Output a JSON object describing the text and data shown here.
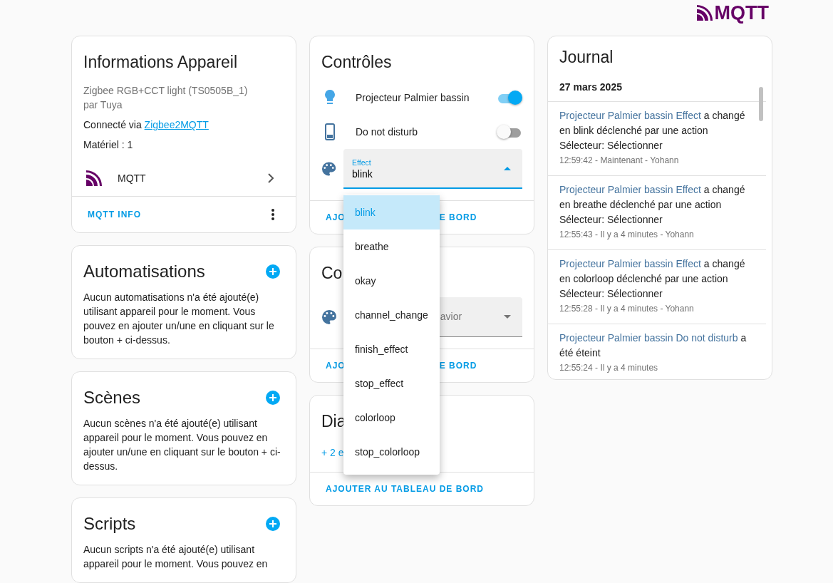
{
  "logo": {
    "text": "MQTT"
  },
  "device_info": {
    "title": "Informations Appareil",
    "model": "Zigbee RGB+CCT light (TS0505B_1)",
    "manufacturer": "par Tuya",
    "connected_label": "Connecté via",
    "connected_link": "Zigbee2MQTT",
    "hardware": "Matériel : 1",
    "integration": "MQTT",
    "action": "MQTT INFO"
  },
  "related": [
    {
      "title": "Automatisations",
      "text": "Aucun automatisations n'a été ajouté(e) utilisant appareil pour le moment. Vous pouvez en ajouter un/une en cliquant sur le bouton + ci-dessus."
    },
    {
      "title": "Scènes",
      "text": "Aucun scènes n'a été ajouté(e) utilisant appareil pour le moment. Vous pouvez en ajouter un/une en cliquant sur le bouton + ci-dessus."
    },
    {
      "title": "Scripts",
      "text": "Aucun scripts n'a été ajouté(e) utilisant appareil pour le moment. Vous pouvez en"
    }
  ],
  "controls": {
    "title": "Contrôles",
    "entities": [
      {
        "kind": "switch",
        "name": "Projecteur Palmier bassin",
        "on": true
      },
      {
        "kind": "switch",
        "name": "Do not disturb",
        "on": false
      },
      {
        "kind": "select",
        "label": "Effect",
        "value": "blink",
        "expanded": true
      }
    ],
    "footer_parts": [
      "AJO",
      "E BORD"
    ]
  },
  "effect_menu": {
    "options": [
      {
        "label": "blink",
        "selected": true
      },
      {
        "label": "breathe",
        "selected": false
      },
      {
        "label": "okay",
        "selected": false
      },
      {
        "label": "channel_change",
        "selected": false
      },
      {
        "label": "finish_effect",
        "selected": false
      },
      {
        "label": "stop_effect",
        "selected": false
      },
      {
        "label": "colorloop",
        "selected": false
      },
      {
        "label": "stop_colorloop",
        "selected": false
      }
    ]
  },
  "configuration": {
    "title": "Co",
    "select_value": "avior",
    "expanded": false,
    "footer_parts": [
      "AJO",
      "E BORD"
    ]
  },
  "diagnostic": {
    "title": "Dia",
    "more": "+ 2 e",
    "footer": "AJOUTER AU TABLEAU DE BORD"
  },
  "journal": {
    "title": "Journal",
    "date": "27 mars 2025",
    "entries": [
      {
        "entity": "Projecteur Palmier bassin Effect",
        "message": "a changé en blink déclenché par une action Sélecteur: Sélectionner",
        "meta": "12:59:42 - Maintenant - Yohann"
      },
      {
        "entity": "Projecteur Palmier bassin Effect",
        "message": "a changé en breathe déclenché par une action Sélecteur: Sélectionner",
        "meta": "12:55:43 - Il y a 4 minutes - Yohann"
      },
      {
        "entity": "Projecteur Palmier bassin Effect",
        "message": "a changé en colorloop déclenché par une action Sélecteur: Sélectionner",
        "meta": "12:55:28 - Il y a 4 minutes - Yohann"
      },
      {
        "entity": "Projecteur Palmier bassin Do not disturb",
        "message": "a été éteint",
        "meta": "12:55:24 - Il y a 4 minutes"
      }
    ]
  }
}
